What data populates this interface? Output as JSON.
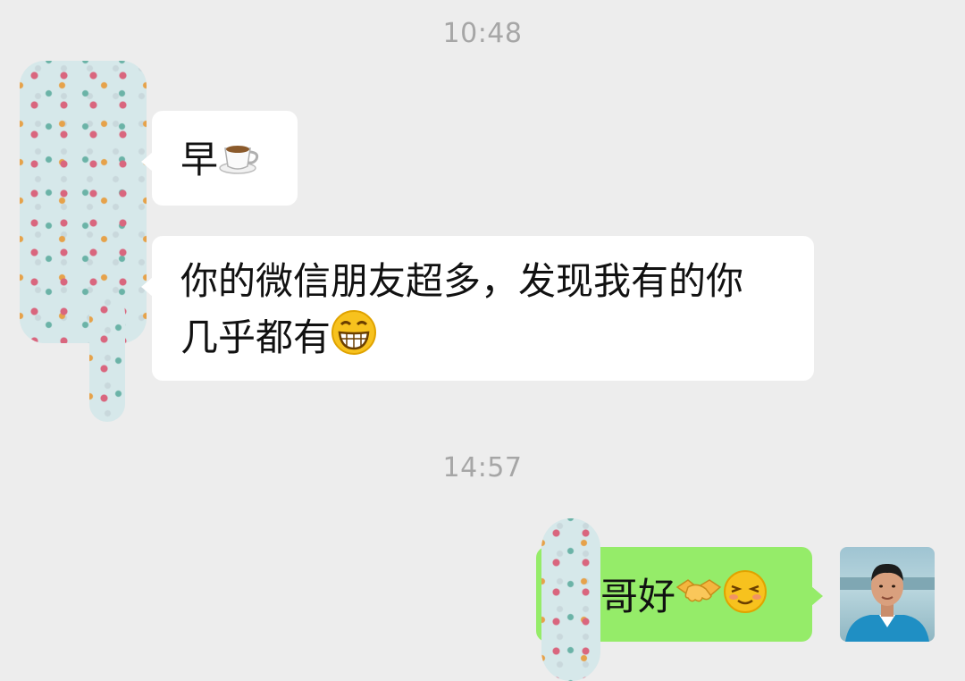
{
  "chat": {
    "timestamps": [
      "10:48",
      "14:57"
    ],
    "messages": [
      {
        "from": "contact",
        "text": "早",
        "emoji": "hot-beverage-emoji"
      },
      {
        "from": "contact",
        "line1": "你的微信朋友超多，发现我有的你",
        "line2": "几乎都有",
        "emoji": "grinning-face-emoji"
      },
      {
        "from": "me",
        "text": "哥好",
        "emoji1": "handshake-emoji",
        "emoji2": "smiling-face-emoji"
      }
    ]
  },
  "colors": {
    "background": "#ededed",
    "incoming_bubble": "#ffffff",
    "outgoing_bubble": "#95ec69",
    "timestamp_text": "#a6a6a6"
  }
}
